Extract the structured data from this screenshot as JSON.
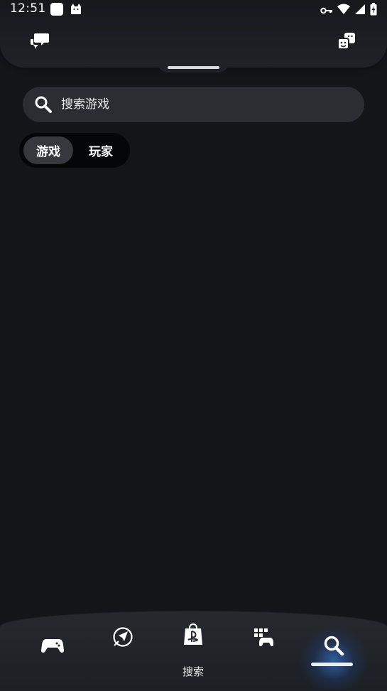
{
  "status_bar": {
    "time": "12:51",
    "icons": [
      "app-square-icon",
      "cat-icon",
      "vpn-key-icon",
      "wifi-icon",
      "signal-icon",
      "battery-charging-icon"
    ]
  },
  "header": {
    "left_icon": "chat-bubbles-icon",
    "right_icon": "friends-icon"
  },
  "search": {
    "placeholder": "搜索游戏",
    "value": ""
  },
  "tabs": [
    {
      "label": "游戏",
      "selected": true
    },
    {
      "label": "玩家",
      "selected": false
    }
  ],
  "bottom_nav": {
    "items": [
      {
        "icon": "gamepad-icon",
        "active": false
      },
      {
        "icon": "explore-icon",
        "active": false
      },
      {
        "icon": "ps-store-icon",
        "active": false
      },
      {
        "icon": "game-library-icon",
        "active": false
      },
      {
        "icon": "search-icon",
        "active": true
      }
    ],
    "active_label": "搜索",
    "accent_color": "#3c8cff"
  }
}
